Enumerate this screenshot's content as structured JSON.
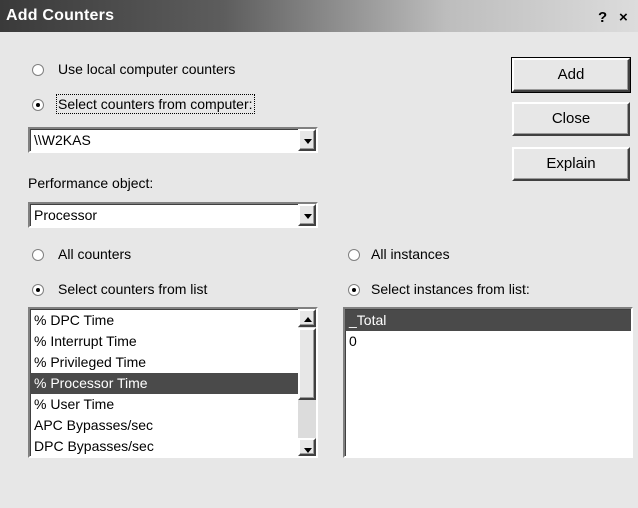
{
  "window": {
    "title": "Add Counters",
    "help_label": "?",
    "close_label": "×"
  },
  "source": {
    "local_label": "Use local computer counters",
    "local_selected": false,
    "remote_label": "Select counters from computer:",
    "remote_selected": true,
    "computer_value": "\\\\W2KAS"
  },
  "buttons": {
    "add": "Add",
    "close": "Close",
    "explain": "Explain"
  },
  "performance_object": {
    "label": "Performance object:",
    "value": "Processor"
  },
  "counters": {
    "all_label": "All counters",
    "all_selected": false,
    "list_label": "Select counters from list",
    "list_selected": true,
    "items": [
      "% DPC Time",
      "% Interrupt Time",
      "% Privileged Time",
      "% Processor Time",
      "% User Time",
      "APC Bypasses/sec",
      "DPC Bypasses/sec"
    ],
    "selected_index": 3
  },
  "instances": {
    "all_label": "All instances",
    "all_selected": false,
    "list_label": "Select instances from list:",
    "list_selected": true,
    "items": [
      "_Total",
      "0"
    ],
    "selected_index": 0
  }
}
